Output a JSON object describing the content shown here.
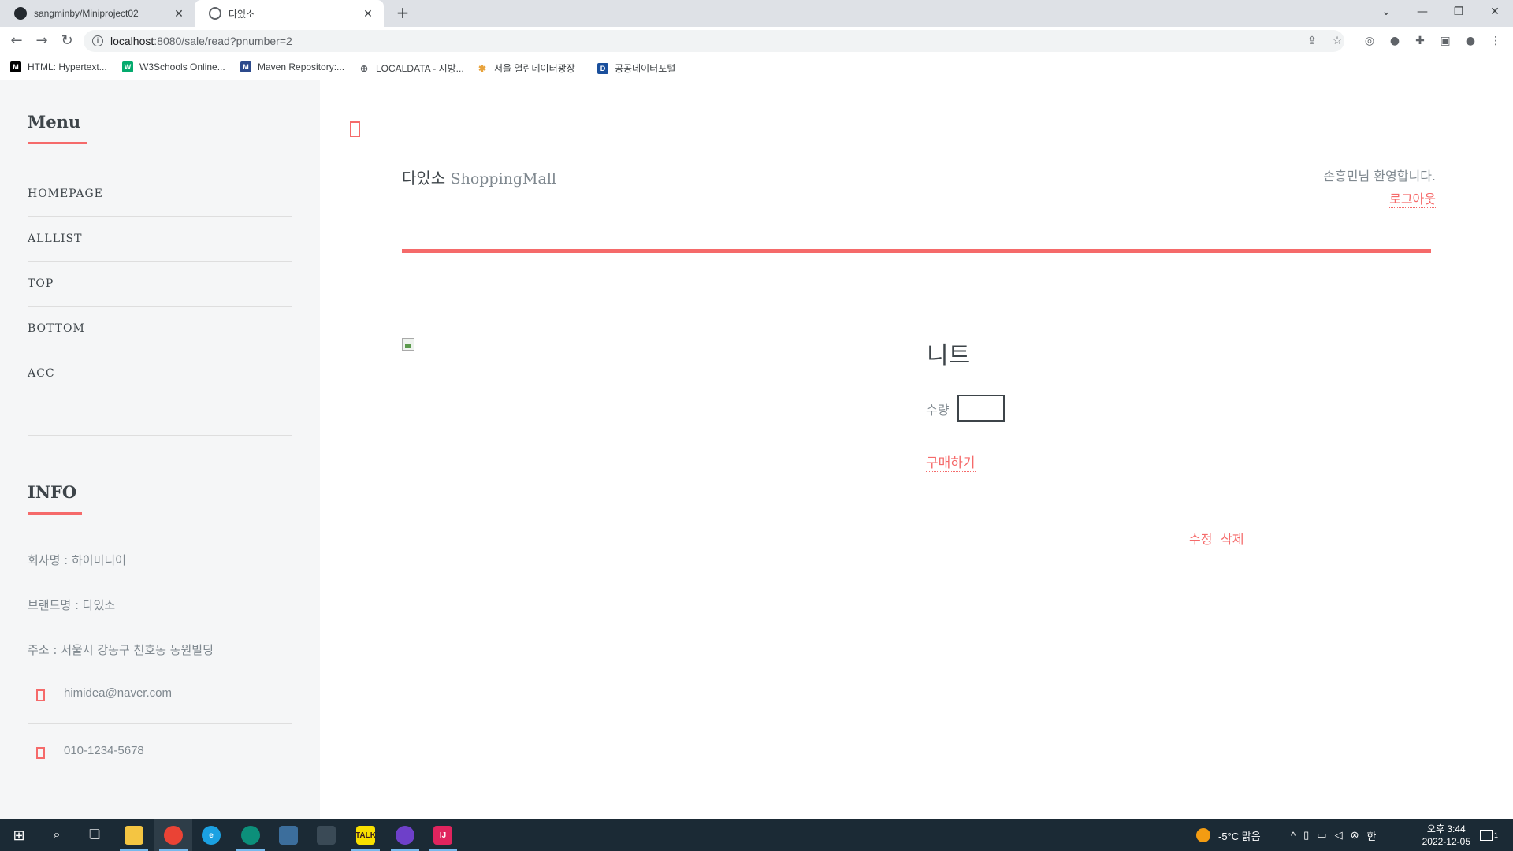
{
  "browser": {
    "tabs": [
      {
        "title": "sangminby/Miniproject02",
        "icon": "github-icon",
        "active": false
      },
      {
        "title": "다있소",
        "icon": "globe-icon",
        "active": true
      }
    ],
    "new_tab": "+",
    "window_controls": {
      "dropdown": "⌄",
      "minimize": "—",
      "restore": "❐",
      "close": "✕"
    },
    "address": {
      "host": "localhost",
      "path": ":8080/sale/read?pnumber=2"
    },
    "bookmarks": [
      {
        "label": "HTML: Hypertext...",
        "icon": "mdn-icon",
        "color": "#000000",
        "glyph": "M"
      },
      {
        "label": "W3Schools Online...",
        "icon": "w3schools-icon",
        "color": "#04aa6d",
        "glyph": "W"
      },
      {
        "label": "Maven Repository:...",
        "icon": "maven-icon",
        "color": "#2c4a8c",
        "glyph": "M"
      },
      {
        "label": "LOCALDATA - 지방...",
        "icon": "globe-icon",
        "color": "#5f6368",
        "glyph": "⊕"
      },
      {
        "label": "서울 열린데이터광장",
        "icon": "seoul-icon",
        "color": "#e8a33c",
        "glyph": "✱"
      },
      {
        "label": "공공데이터포털",
        "icon": "datagokr-icon",
        "color": "#1a4f9c",
        "glyph": "D"
      }
    ]
  },
  "sidebar": {
    "menu_title": "Menu",
    "menu_items": [
      "HOMEPAGE",
      "ALLLIST",
      "TOP",
      "BOTTOM",
      "ACC"
    ],
    "info_title": "INFO",
    "info_lines": [
      "회사명 : 하이미디어",
      "브랜드명 : 다있소",
      "주소 : 서울시 강동구 천호동 동원빌딩"
    ],
    "email": "himidea@naver.com",
    "phone": "010-1234-5678"
  },
  "header": {
    "brand": "다있소",
    "brand_sub": "ShoppingMall",
    "welcome": "손흥민님 환영합니다.",
    "logout": "로그아웃"
  },
  "product": {
    "name": "니트",
    "qty_label": "수량",
    "qty_value": "",
    "buy": "구매하기",
    "edit": "수정",
    "delete": "삭제"
  },
  "taskbar": {
    "weather": "-5°C  맑음",
    "ime": "한",
    "time": "오후 3:44",
    "date": "2022-12-05",
    "notifications": "1",
    "colors": {
      "accent": "#f56a6a",
      "taskbar": "#1b2a35",
      "sidebar": "#f5f6f7"
    }
  }
}
